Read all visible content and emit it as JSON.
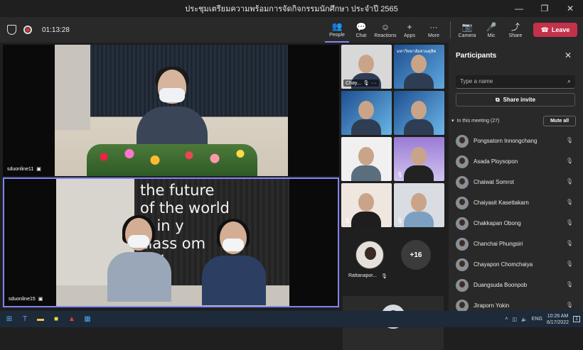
{
  "window": {
    "title": "ประชุมเตรียมความพร้อมการจัดกิจกรรมนักศึกษา ประจำปี 2565",
    "minimize": "—",
    "maximize": "❐",
    "close": "✕"
  },
  "toolbar": {
    "timer": "01:13:28",
    "buttons": [
      {
        "label": "People",
        "icon": "👥"
      },
      {
        "label": "Chat",
        "icon": "💬"
      },
      {
        "label": "Reactions",
        "icon": "☺"
      },
      {
        "label": "Apps",
        "icon": "+"
      },
      {
        "label": "More",
        "icon": "···"
      },
      {
        "label": "Camera",
        "icon": "📷"
      },
      {
        "label": "Mic",
        "icon": "🎤"
      },
      {
        "label": "Share",
        "icon": "⤴"
      }
    ],
    "leave_label": "Leave"
  },
  "stage": {
    "video1_label": "sduonline11",
    "video2_label": "sduonline15",
    "board_text": [
      "the future",
      "of the world",
      "is in  y",
      "class  om",
      "tod"
    ]
  },
  "gallery": {
    "tile1_name": "Chay...",
    "tile2_banner": "มหาวิทยาลัยสวนดุสิต",
    "rattanaporn_name": "Rattanapor...",
    "plus_count": "+16"
  },
  "participants": {
    "heading": "Participants",
    "search_placeholder": "Type a name",
    "share_invite": "Share invite",
    "section_label": "In this meeting (27)",
    "mute_all": "Mute all",
    "list": [
      "Pongsatorn Innongchang",
      "Asada Ploysopon",
      "Chaiwat Somrot",
      "Chaiyasit Kasettakarn",
      "Chakkapan Obong",
      "Chanchai Phungsiri",
      "Chayapon Chomchaiya",
      "Duangsuda Boonpob",
      "Jiraporn Yokin"
    ]
  },
  "taskbar": {
    "lang": "ENG",
    "time": "10:26 AM",
    "date": "6/17/2022",
    "notif": "1"
  },
  "colors": {
    "accent": "#7f85f5",
    "leave": "#c4314b",
    "panel": "#292929"
  }
}
